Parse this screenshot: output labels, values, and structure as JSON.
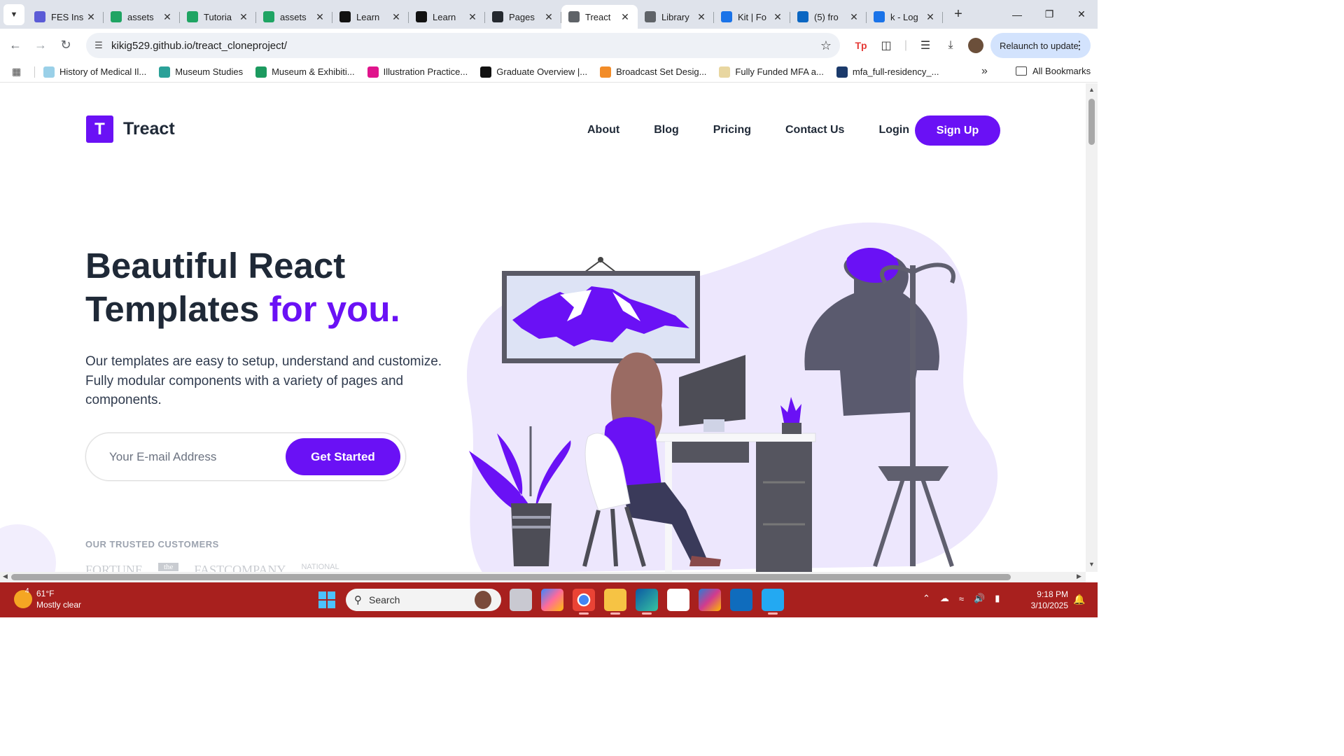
{
  "browser": {
    "tabs": [
      {
        "title": "FES Ins",
        "favicon_color": "#5b5bd6",
        "active": false
      },
      {
        "title": "assets",
        "favicon_color": "#1fa463",
        "active": false
      },
      {
        "title": "Tutoria",
        "favicon_color": "#1fa463",
        "active": false
      },
      {
        "title": "assets",
        "favicon_color": "#1fa463",
        "active": false
      },
      {
        "title": "Learn",
        "favicon_color": "#111111",
        "active": false
      },
      {
        "title": "Learn",
        "favicon_color": "#111111",
        "active": false
      },
      {
        "title": "Pages",
        "favicon_color": "#24292f",
        "active": false
      },
      {
        "title": "Treact",
        "favicon_color": "#5f6368",
        "active": true
      },
      {
        "title": "Library",
        "favicon_color": "#5f6368",
        "active": false
      },
      {
        "title": "Kit | Fo",
        "favicon_color": "#1a73e8",
        "active": false
      },
      {
        "title": "(5) fro",
        "favicon_color": "#0a66c2",
        "active": false
      },
      {
        "title": "k - Log",
        "favicon_color": "#1a73e8",
        "active": false
      }
    ],
    "url": "kikig529.github.io/treact_cloneproject/",
    "relaunch_label": "Relaunch to update",
    "bookmarks": [
      {
        "label": "History of Medical Il...",
        "color": "#9ad0e8"
      },
      {
        "label": "Museum Studies",
        "color": "#2aa198"
      },
      {
        "label": "Museum & Exhibiti...",
        "color": "#1c9a5f"
      },
      {
        "label": "Illustration Practice...",
        "color": "#e0148c"
      },
      {
        "label": "Graduate Overview |...",
        "color": "#111111"
      },
      {
        "label": "Broadcast Set Desig...",
        "color": "#f28c28"
      },
      {
        "label": "Fully Funded MFA a...",
        "color": "#e8d6a0"
      },
      {
        "label": "mfa_full-residency_...",
        "color": "#1b3a6b"
      }
    ],
    "all_bookmarks_label": "All Bookmarks"
  },
  "site": {
    "logo_letter": "T",
    "brand": "Treact",
    "nav": [
      "About",
      "Blog",
      "Pricing",
      "Contact Us",
      "Login"
    ],
    "signup_label": "Sign Up",
    "hero": {
      "title_line1": "Beautiful React",
      "title_line2": "Templates",
      "title_accent": "for you.",
      "subtitle": "Our templates are easy to setup, understand and customize. Fully modular components with a variety of pages and components.",
      "email_placeholder": "Your E-mail Address",
      "cta_label": "Get Started"
    },
    "trusted_label": "OUR TRUSTED CUSTOMERS",
    "customer_logos": [
      "FORTUNE",
      "the",
      "FASTCOMPANY",
      "NATIONAL"
    ],
    "accent_color": "#6a11f5"
  },
  "taskbar": {
    "weather_badge": "4",
    "temperature": "61°F",
    "condition": "Mostly clear",
    "search_label": "Search",
    "time": "9:18 PM",
    "date": "3/10/2025"
  }
}
